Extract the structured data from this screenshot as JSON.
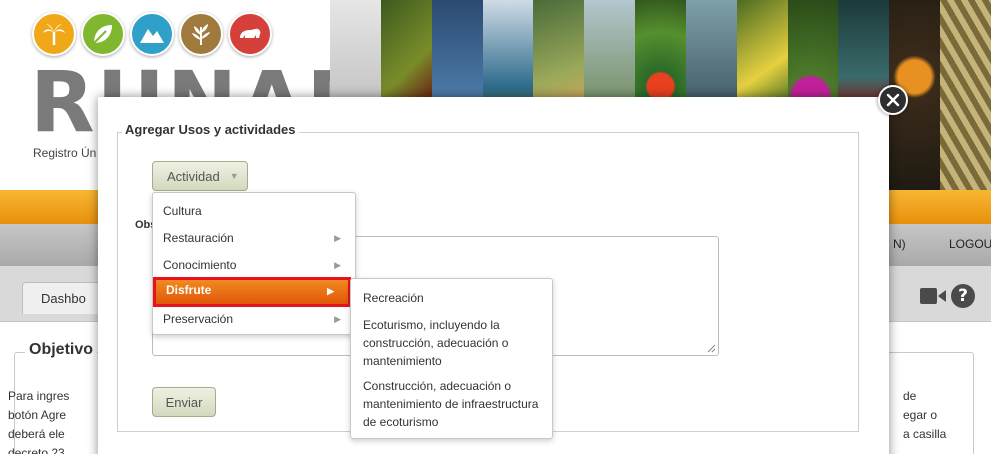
{
  "header": {
    "logo_text": "RUNAP",
    "subtitle": "Registro Ún",
    "logo_icons": [
      "palm-tree-icon",
      "leaf-icon",
      "mountain-icon",
      "plant-icon",
      "bear-icon"
    ]
  },
  "nav": {
    "user_fragment": "N)",
    "logout_label": "LOGOUT",
    "dashboard_tab": "Dashbo"
  },
  "objetivo": {
    "legend": "Objetivo",
    "left_lines": [
      "Para ingres",
      "botón Agre",
      "deberá ele",
      "decreto 23"
    ],
    "right_lines": [
      "de",
      "egar o",
      "a casilla"
    ]
  },
  "modal": {
    "legend": "Agregar Usos y actividades",
    "actividad_label": "Actividad",
    "obs_label": "Obs",
    "enviar_label": "Enviar",
    "textarea_value": ""
  },
  "menu": {
    "items": [
      {
        "label": "Cultura",
        "has_submenu": false
      },
      {
        "label": "Restauración",
        "has_submenu": true
      },
      {
        "label": "Conocimiento",
        "has_submenu": true
      },
      {
        "label": "Disfrute",
        "has_submenu": true,
        "active": true
      },
      {
        "label": "Preservación",
        "has_submenu": true
      }
    ],
    "submenu": [
      "Recreación",
      "Ecoturismo, incluyendo la construcción, adecuación o mantenimiento",
      "Construcción, adecuación o mantenimiento de infraestructura de ecoturismo"
    ]
  },
  "colors": {
    "accent_orange": "#e8900b",
    "active_item": "#f06a16",
    "highlight_border": "#e8121f",
    "button_green": "#d3d9bd"
  }
}
